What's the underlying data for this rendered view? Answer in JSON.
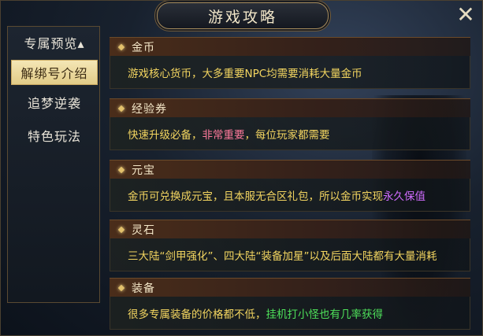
{
  "window": {
    "title": "游戏攻略",
    "close_icon": "close-icon"
  },
  "sidebar": {
    "items": [
      {
        "label": "专属预览▴",
        "active": false
      },
      {
        "label": "解绑号介绍",
        "active": true
      },
      {
        "label": "追梦逆袭",
        "active": false
      },
      {
        "label": "特色玩法",
        "active": false
      }
    ]
  },
  "sections": [
    {
      "title": "金币",
      "text": "游戏核心货币，大多重要NPC均需要消耗大量金币"
    },
    {
      "title": "经验券",
      "text_a": "快速升级必备，",
      "highlight": "非常重要",
      "text_b": "，每位玩家都需要",
      "highlight_color": "#ff7a9c"
    },
    {
      "title": "元宝",
      "text_a": "金币可兑换成元宝，且本服无合区礼包，所以金币实现",
      "highlight": "永久保值",
      "text_b": "",
      "highlight_color": "#d06cff"
    },
    {
      "title": "灵石",
      "text": "三大陆“剑甲强化”、四大陆“装备加星”以及后面大陆都有大量消耗"
    },
    {
      "title": "装备",
      "text_a": "很多专属装备的价格都不低，",
      "highlight": "挂机打小怪也有几率获得",
      "text_b": "",
      "highlight_color": "#4ee05a"
    }
  ],
  "colors": {
    "body_text": "#f3d560",
    "header_text": "#f4e7c8",
    "active_tab_bg": "#f4e6b5"
  }
}
